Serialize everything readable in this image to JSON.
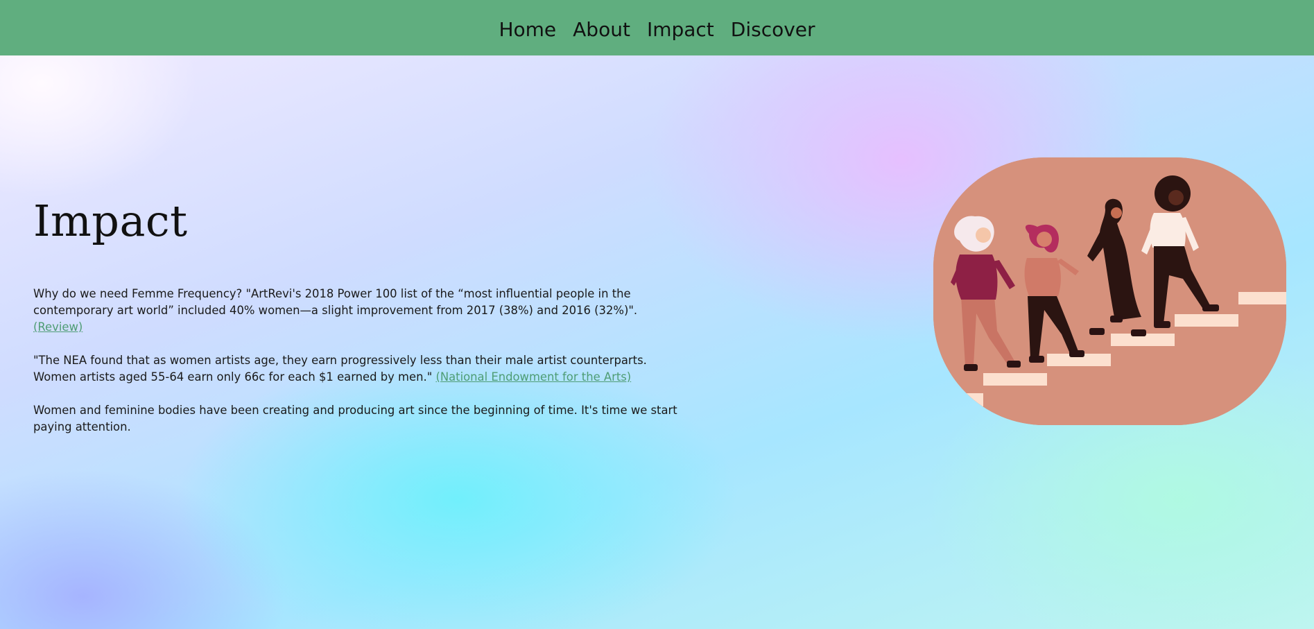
{
  "nav": {
    "home": "Home",
    "about": "About",
    "impact": "Impact",
    "discover": "Discover"
  },
  "page": {
    "title": "Impact",
    "p1_text": "Why do we need Femme Frequency? \"ArtRevi's 2018 Power 100 list of the “most influential people in the contemporary art world” included 40% women—a slight improvement from 2017 (38%) and 2016 (32%)\". ",
    "p1_link": "(Review)",
    "p2_text": "\"The NEA found that as women artists age, they earn progressively less than their male artist counterparts. Women artists aged 55-64 earn only 66c for each $1 earned by men.\" ",
    "p2_link": "(National Endowment for the Arts)",
    "p3_text": "Women and feminine bodies have been creating and producing art since the beginning of time. It's time we start paying attention."
  },
  "hero_image": {
    "alt": "women-climbing-stairs-illustration",
    "background": "#d6917c"
  },
  "colors": {
    "nav_bg": "#60ae7f",
    "link": "#4f9d74"
  }
}
